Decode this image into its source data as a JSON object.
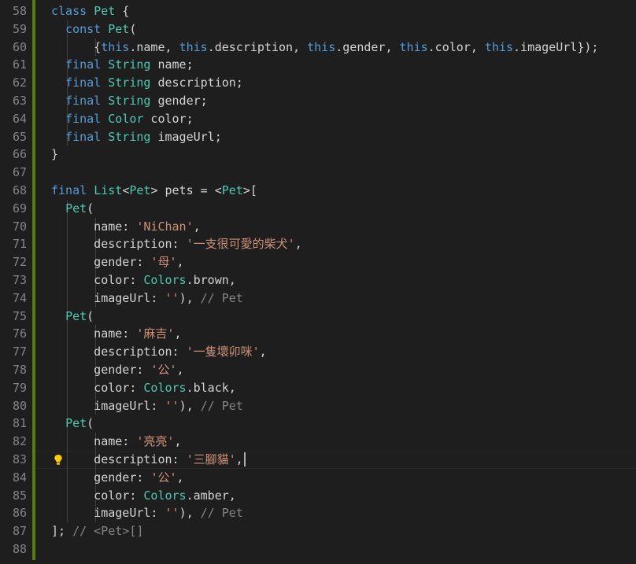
{
  "editor": {
    "lines": [
      {
        "n": "58",
        "tokens": [
          [
            "kw",
            "class"
          ],
          [
            "pl",
            " "
          ],
          [
            "ty",
            "Pet"
          ],
          [
            "pl",
            " {"
          ]
        ]
      },
      {
        "n": "59",
        "tokens": [
          [
            "pl",
            "  "
          ],
          [
            "kw",
            "const"
          ],
          [
            "pl",
            " "
          ],
          [
            "ty",
            "Pet"
          ],
          [
            "pl",
            "("
          ]
        ]
      },
      {
        "n": "60",
        "tokens": [
          [
            "pl",
            "      {"
          ],
          [
            "kw",
            "this"
          ],
          [
            "pl",
            ".name, "
          ],
          [
            "kw",
            "this"
          ],
          [
            "pl",
            ".description, "
          ],
          [
            "kw",
            "this"
          ],
          [
            "pl",
            ".gender, "
          ],
          [
            "kw",
            "this"
          ],
          [
            "pl",
            ".color, "
          ],
          [
            "kw",
            "this"
          ],
          [
            "pl",
            ".imageUrl});"
          ]
        ]
      },
      {
        "n": "61",
        "tokens": [
          [
            "pl",
            "  "
          ],
          [
            "kw",
            "final"
          ],
          [
            "pl",
            " "
          ],
          [
            "ty",
            "String"
          ],
          [
            "pl",
            " name;"
          ]
        ]
      },
      {
        "n": "62",
        "tokens": [
          [
            "pl",
            "  "
          ],
          [
            "kw",
            "final"
          ],
          [
            "pl",
            " "
          ],
          [
            "ty",
            "String"
          ],
          [
            "pl",
            " description;"
          ]
        ]
      },
      {
        "n": "63",
        "tokens": [
          [
            "pl",
            "  "
          ],
          [
            "kw",
            "final"
          ],
          [
            "pl",
            " "
          ],
          [
            "ty",
            "String"
          ],
          [
            "pl",
            " gender;"
          ]
        ]
      },
      {
        "n": "64",
        "tokens": [
          [
            "pl",
            "  "
          ],
          [
            "kw",
            "final"
          ],
          [
            "pl",
            " "
          ],
          [
            "ty",
            "Color"
          ],
          [
            "pl",
            " color;"
          ]
        ]
      },
      {
        "n": "65",
        "tokens": [
          [
            "pl",
            "  "
          ],
          [
            "kw",
            "final"
          ],
          [
            "pl",
            " "
          ],
          [
            "ty",
            "String"
          ],
          [
            "pl",
            " imageUrl;"
          ]
        ]
      },
      {
        "n": "66",
        "tokens": [
          [
            "pl",
            "}"
          ]
        ]
      },
      {
        "n": "67",
        "tokens": []
      },
      {
        "n": "68",
        "tokens": [
          [
            "kw",
            "final"
          ],
          [
            "pl",
            " "
          ],
          [
            "ty",
            "List"
          ],
          [
            "pl",
            "<"
          ],
          [
            "ty",
            "Pet"
          ],
          [
            "pl",
            "> pets = <"
          ],
          [
            "ty",
            "Pet"
          ],
          [
            "pl",
            ">["
          ]
        ]
      },
      {
        "n": "69",
        "tokens": [
          [
            "pl",
            "  "
          ],
          [
            "ty",
            "Pet"
          ],
          [
            "pl",
            "("
          ]
        ]
      },
      {
        "n": "70",
        "tokens": [
          [
            "pl",
            "      name: "
          ],
          [
            "st",
            "'NiChan'"
          ],
          [
            "pl",
            ","
          ]
        ]
      },
      {
        "n": "71",
        "tokens": [
          [
            "pl",
            "      description: "
          ],
          [
            "st",
            "'一支很可愛的柴犬'"
          ],
          [
            "pl",
            ","
          ]
        ]
      },
      {
        "n": "72",
        "tokens": [
          [
            "pl",
            "      gender: "
          ],
          [
            "st",
            "'母'"
          ],
          [
            "pl",
            ","
          ]
        ]
      },
      {
        "n": "73",
        "tokens": [
          [
            "pl",
            "      color: "
          ],
          [
            "ty",
            "Colors"
          ],
          [
            "pl",
            ".brown,"
          ]
        ]
      },
      {
        "n": "74",
        "tokens": [
          [
            "pl",
            "      imageUrl: "
          ],
          [
            "st",
            "''"
          ],
          [
            "pl",
            "), "
          ],
          [
            "cmg",
            "// Pet"
          ]
        ]
      },
      {
        "n": "75",
        "tokens": [
          [
            "pl",
            "  "
          ],
          [
            "ty",
            "Pet"
          ],
          [
            "pl",
            "("
          ]
        ]
      },
      {
        "n": "76",
        "tokens": [
          [
            "pl",
            "      name: "
          ],
          [
            "st",
            "'麻吉'"
          ],
          [
            "pl",
            ","
          ]
        ]
      },
      {
        "n": "77",
        "tokens": [
          [
            "pl",
            "      description: "
          ],
          [
            "st",
            "'一隻壞卯咪'"
          ],
          [
            "pl",
            ","
          ]
        ]
      },
      {
        "n": "78",
        "tokens": [
          [
            "pl",
            "      gender: "
          ],
          [
            "st",
            "'公'"
          ],
          [
            "pl",
            ","
          ]
        ]
      },
      {
        "n": "79",
        "tokens": [
          [
            "pl",
            "      color: "
          ],
          [
            "ty",
            "Colors"
          ],
          [
            "pl",
            ".black,"
          ]
        ]
      },
      {
        "n": "80",
        "tokens": [
          [
            "pl",
            "      imageUrl: "
          ],
          [
            "st",
            "''"
          ],
          [
            "pl",
            "), "
          ],
          [
            "cmg",
            "// Pet"
          ]
        ]
      },
      {
        "n": "81",
        "tokens": [
          [
            "pl",
            "  "
          ],
          [
            "ty",
            "Pet"
          ],
          [
            "pl",
            "("
          ]
        ]
      },
      {
        "n": "82",
        "tokens": [
          [
            "pl",
            "      name: "
          ],
          [
            "st",
            "'亮亮'"
          ],
          [
            "pl",
            ","
          ]
        ]
      },
      {
        "n": "83",
        "tokens": [
          [
            "pl",
            "      description: "
          ],
          [
            "st",
            "'三腳貓'"
          ],
          [
            "pl",
            ","
          ]
        ]
      },
      {
        "n": "84",
        "tokens": [
          [
            "pl",
            "      gender: "
          ],
          [
            "st",
            "'公'"
          ],
          [
            "pl",
            ","
          ]
        ]
      },
      {
        "n": "85",
        "tokens": [
          [
            "pl",
            "      color: "
          ],
          [
            "ty",
            "Colors"
          ],
          [
            "pl",
            ".amber,"
          ]
        ]
      },
      {
        "n": "86",
        "tokens": [
          [
            "pl",
            "      imageUrl: "
          ],
          [
            "st",
            "''"
          ],
          [
            "pl",
            "), "
          ],
          [
            "cmg",
            "// Pet"
          ]
        ]
      },
      {
        "n": "87",
        "tokens": [
          [
            "pl",
            "]; "
          ],
          [
            "cmg",
            "// <Pet>[]"
          ]
        ]
      },
      {
        "n": "88",
        "tokens": []
      }
    ],
    "lightbulb_line": "83",
    "cursor_line": "83",
    "icons": {
      "lightbulb": "lightbulb-icon"
    },
    "colors": {
      "background": "#1e1e1e",
      "keyword": "#569cd6",
      "type": "#4ec9b0",
      "string": "#ce9178",
      "plain": "#d4d4d4",
      "line_number": "#858585",
      "git_added": "#587c0c",
      "lightbulb": "#ffcc00"
    }
  }
}
